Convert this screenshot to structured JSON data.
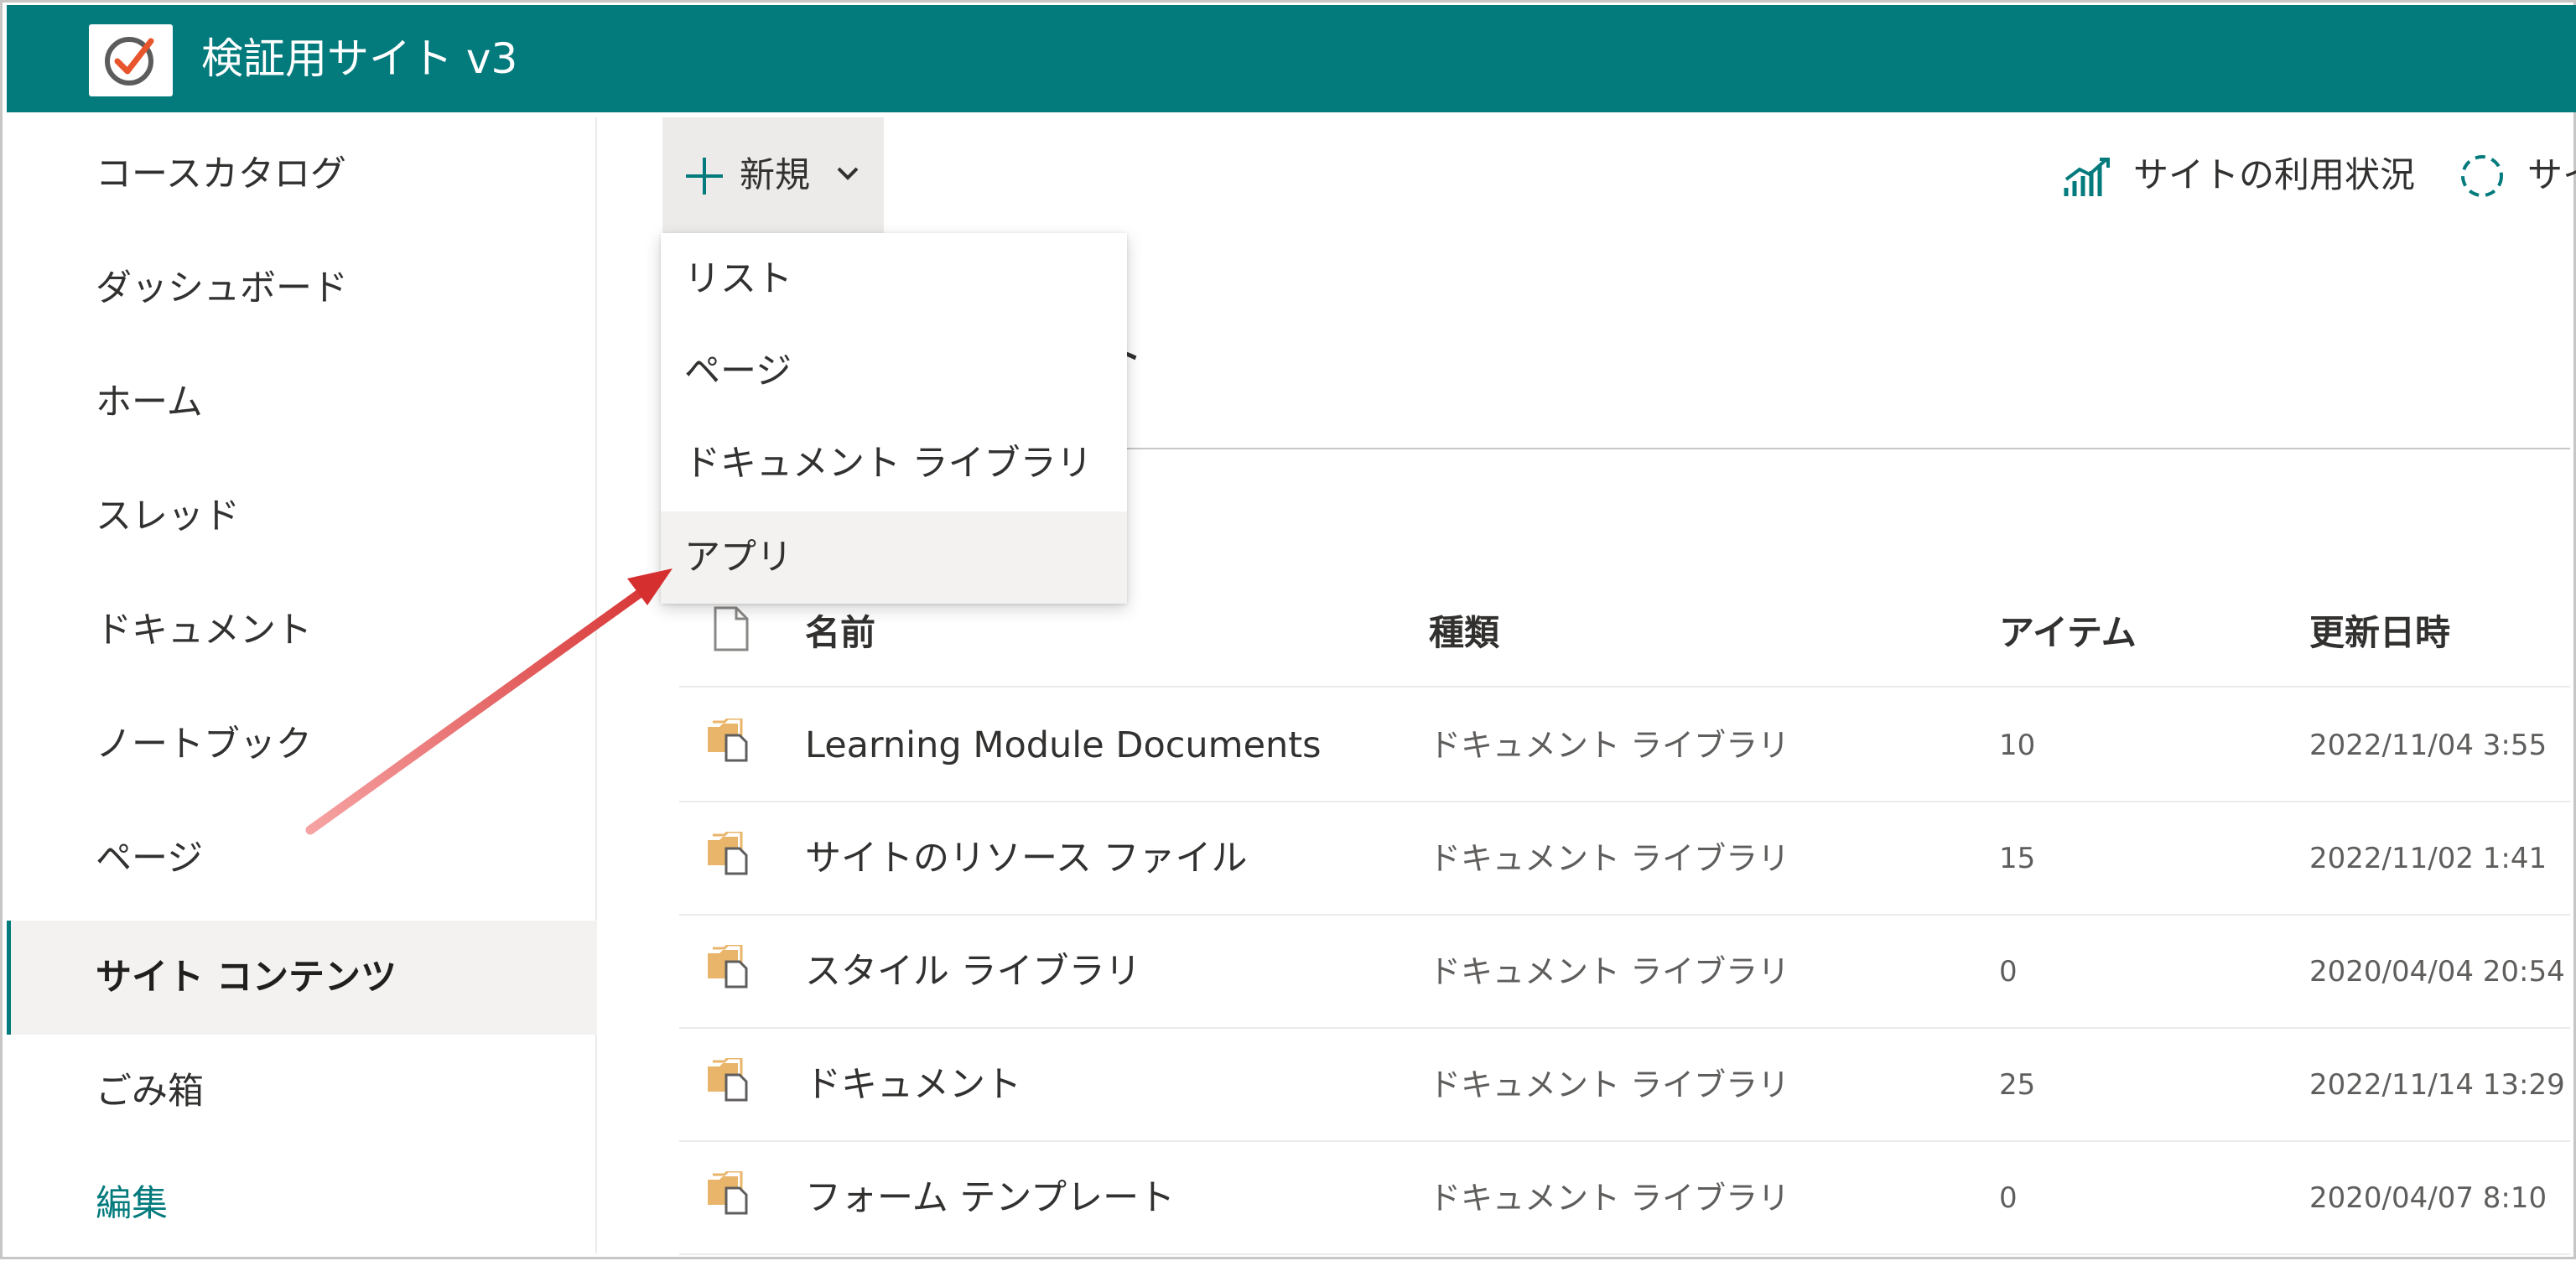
{
  "header": {
    "site_title": "検証用サイト v3",
    "bar_color": "#037a7c"
  },
  "sidebar": {
    "items": [
      {
        "label": "コースカタログ"
      },
      {
        "label": "ダッシュボード"
      },
      {
        "label": "ホーム"
      },
      {
        "label": "スレッド"
      },
      {
        "label": "ドキュメント"
      },
      {
        "label": "ノートブック"
      },
      {
        "label": "ページ"
      },
      {
        "label": "サイト コンテンツ",
        "selected": true
      },
      {
        "label": "ごみ箱"
      }
    ],
    "edit_label": "編集"
  },
  "command_bar": {
    "new_label": "新規",
    "usage_label": "サイトの利用状況",
    "workflow_label": "サイ"
  },
  "page": {
    "heading_visible_fragment": "ト"
  },
  "new_menu": {
    "items": [
      {
        "label": "リスト"
      },
      {
        "label": "ページ"
      },
      {
        "label": "ドキュメント ライブラリ"
      },
      {
        "label": "アプリ",
        "highlighted": true
      }
    ]
  },
  "table": {
    "columns": {
      "name": "名前",
      "type": "種類",
      "items": "アイテム",
      "modified": "更新日時"
    },
    "rows": [
      {
        "name": "Learning Module Documents",
        "type": "ドキュメント ライブラリ",
        "items": "10",
        "modified": "2022/11/04 3:55"
      },
      {
        "name": "サイトのリソース ファイル",
        "type": "ドキュメント ライブラリ",
        "items": "15",
        "modified": "2022/11/02 1:41"
      },
      {
        "name": "スタイル ライブラリ",
        "type": "ドキュメント ライブラリ",
        "items": "0",
        "modified": "2020/04/04 20:54"
      },
      {
        "name": "ドキュメント",
        "type": "ドキュメント ライブラリ",
        "items": "25",
        "modified": "2022/11/14 13:29"
      },
      {
        "name": "フォーム テンプレート",
        "type": "ドキュメント ライブラリ",
        "items": "0",
        "modified": "2020/04/07 8:10"
      }
    ]
  },
  "icons": {
    "logo": "checkmark-circle-logo",
    "new": "plus-icon",
    "chevron": "chevron-down-icon",
    "usage": "chart-icon",
    "workflow": "dashed-circle-icon",
    "file": "document-icon",
    "library": "library-folder-icon"
  },
  "annotation": {
    "arrow_color": "#d62f2f"
  }
}
